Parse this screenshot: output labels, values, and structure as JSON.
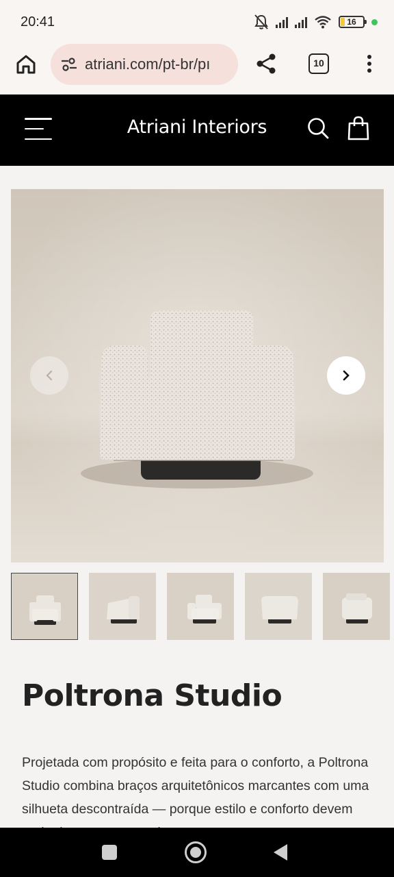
{
  "status_bar": {
    "time": "20:41",
    "battery_level": "16",
    "icons": [
      "bell-off-icon",
      "signal-icon",
      "signal-icon",
      "wifi-icon",
      "battery-icon"
    ]
  },
  "browser": {
    "url": "atriani.com/pt-br/pı",
    "tab_count": "10"
  },
  "site": {
    "brand": "Atriani Interiors"
  },
  "gallery": {
    "thumbnail_count": 5,
    "active_index": 0
  },
  "product": {
    "title": "Poltrona Studio",
    "description": "Projetada com propósito e feita para o conforto, a Poltrona Studio combina braços arquitetônicos marcantes com uma silhueta descontraída — porque estilo e conforto devem andar juntos, e esta poltrona"
  },
  "colors": {
    "header_bg": "#000000",
    "page_bg": "#f4f3f1",
    "url_pill": "#f6e0dc",
    "battery": "#f2c744",
    "status_dot": "#3ec65c"
  }
}
